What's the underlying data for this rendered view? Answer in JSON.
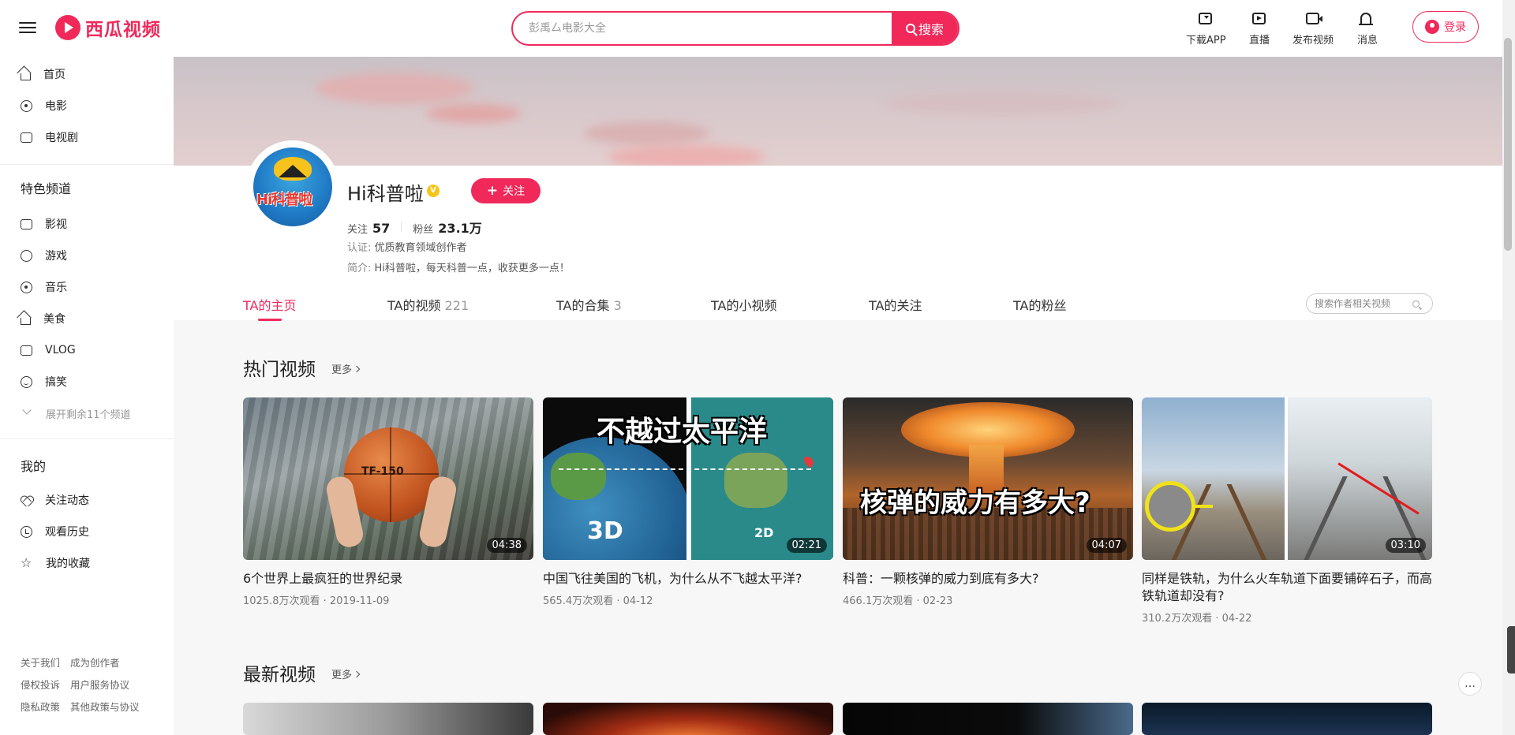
{
  "header": {
    "logo_text": "西瓜视频",
    "search_placeholder": "彭禹厶电影大全",
    "search_button": "搜索",
    "actions": {
      "download": "下载APP",
      "live": "直播",
      "publish": "发布视频",
      "messages": "消息"
    },
    "login": "登录"
  },
  "sidebar": {
    "main_items": [
      {
        "label": "首页",
        "icon": "home-icon"
      },
      {
        "label": "电影",
        "icon": "film-icon"
      },
      {
        "label": "电视剧",
        "icon": "tv-icon"
      }
    ],
    "featured_title": "特色频道",
    "featured_items": [
      {
        "label": "影视",
        "icon": "clapper-icon"
      },
      {
        "label": "游戏",
        "icon": "gamepad-icon"
      },
      {
        "label": "音乐",
        "icon": "music-icon"
      },
      {
        "label": "美食",
        "icon": "food-icon"
      },
      {
        "label": "VLOG",
        "icon": "camera-icon"
      },
      {
        "label": "搞笑",
        "icon": "smile-icon"
      }
    ],
    "expand_label": "展开剩余11个频道",
    "mine_title": "我的",
    "mine_items": [
      {
        "label": "关注动态",
        "icon": "heart-icon"
      },
      {
        "label": "观看历史",
        "icon": "clock-icon"
      },
      {
        "label": "我的收藏",
        "icon": "star-icon"
      }
    ],
    "footer_links": [
      "关于我们",
      "成为创作者",
      "侵权投诉",
      "用户服务协议",
      "隐私政策",
      "其他政策与协议"
    ]
  },
  "profile": {
    "avatar_text": "Hi科普啦",
    "name": "Hi科普啦",
    "verified_badge": "V",
    "follow_button": "关注",
    "following_label": "关注",
    "following_count": "57",
    "fans_label": "粉丝",
    "fans_count": "23.1万",
    "cert_label": "认证:",
    "cert_value": "优质教育领域创作者",
    "intro_label": "简介:",
    "intro_value": "Hi科普啦，每天科普一点，收获更多一点！"
  },
  "tabs": [
    {
      "label": "TA的主页",
      "count": ""
    },
    {
      "label": "TA的视频",
      "count": "221"
    },
    {
      "label": "TA的合集",
      "count": "3"
    },
    {
      "label": "TA的小视频",
      "count": ""
    },
    {
      "label": "TA的关注",
      "count": ""
    },
    {
      "label": "TA的粉丝",
      "count": ""
    }
  ],
  "tab_search_placeholder": "搜索作者相关视频",
  "hot": {
    "title": "热门视频",
    "more": "更多",
    "videos": [
      {
        "title": "6个世界上最疯狂的世界纪录",
        "meta": "1025.8万次观看 · 2019-11-09",
        "duration": "04:38",
        "thumb_text": "TF-150"
      },
      {
        "title": "中国飞往美国的飞机，为什么从不飞越太平洋?",
        "meta": "565.4万次观看 · 04-12",
        "duration": "02:21",
        "thumb_text": "不越过太平洋",
        "thumb_sub_left": "3D",
        "thumb_sub_right": "2D"
      },
      {
        "title": "科普：一颗核弹的威力到底有多大?",
        "meta": "466.1万次观看 · 02-23",
        "duration": "04:07",
        "thumb_text": "核弹的威力有多大?"
      },
      {
        "title": "同样是铁轨，为什么火车轨道下面要铺碎石子，而高铁轨道却没有?",
        "meta": "310.2万次观看 · 04-22",
        "duration": "03:10",
        "thumb_text": ""
      }
    ]
  },
  "latest": {
    "title": "最新视频",
    "more": "更多"
  },
  "colors": {
    "accent": "#f0295a",
    "verified": "#f5c518"
  }
}
